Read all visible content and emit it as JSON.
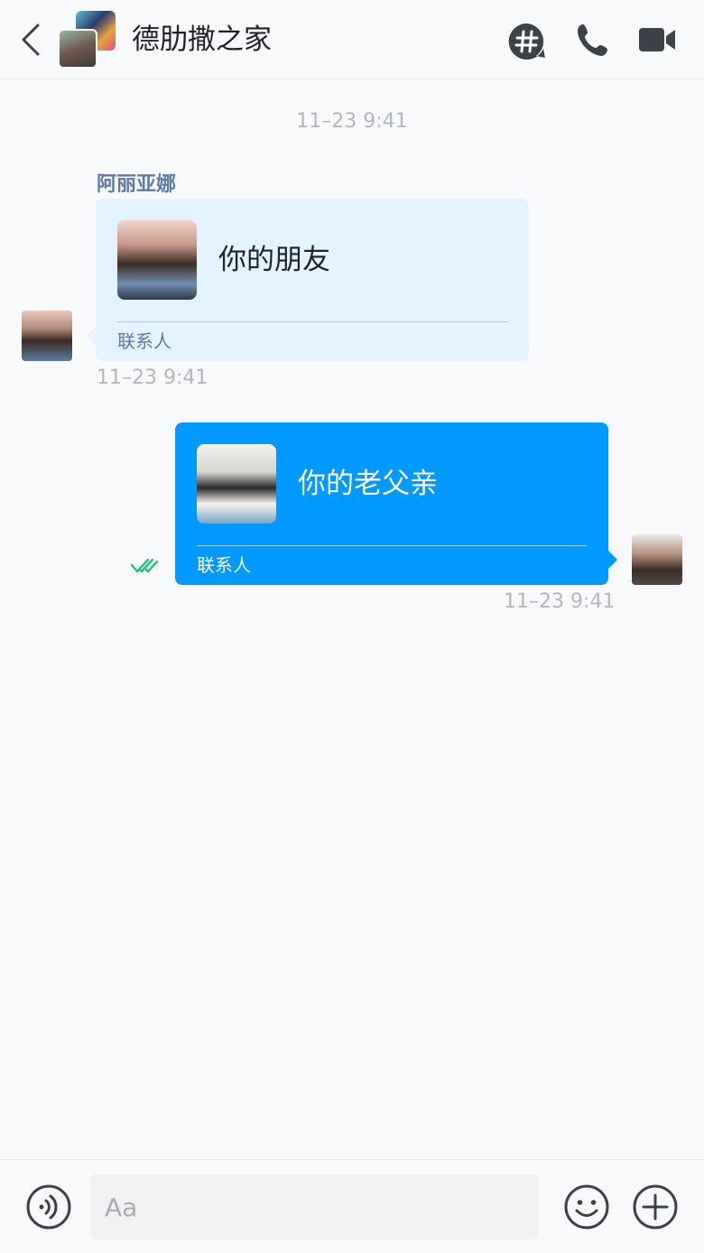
{
  "header": {
    "title": "德肋撒之家"
  },
  "messages": {
    "center_timestamp": "11–23 9:41",
    "incoming": {
      "sender": "阿丽亚娜",
      "card_name": "你的朋友",
      "card_type": "联系人",
      "time": "11–23 9:41"
    },
    "outgoing": {
      "card_name": "你的老父亲",
      "card_type": "联系人",
      "time": "11–23 9:41"
    }
  },
  "composer": {
    "placeholder": "Aa"
  },
  "colors": {
    "accent": "#0099ff",
    "incoming_bubble": "#e3f3ff",
    "read_check": "#22c07a",
    "icon": "#3d4248"
  },
  "icons": [
    "back-icon",
    "hashtag-icon",
    "phone-icon",
    "video-camera-icon",
    "double-check-icon",
    "voice-icon",
    "emoji-icon",
    "plus-icon"
  ]
}
